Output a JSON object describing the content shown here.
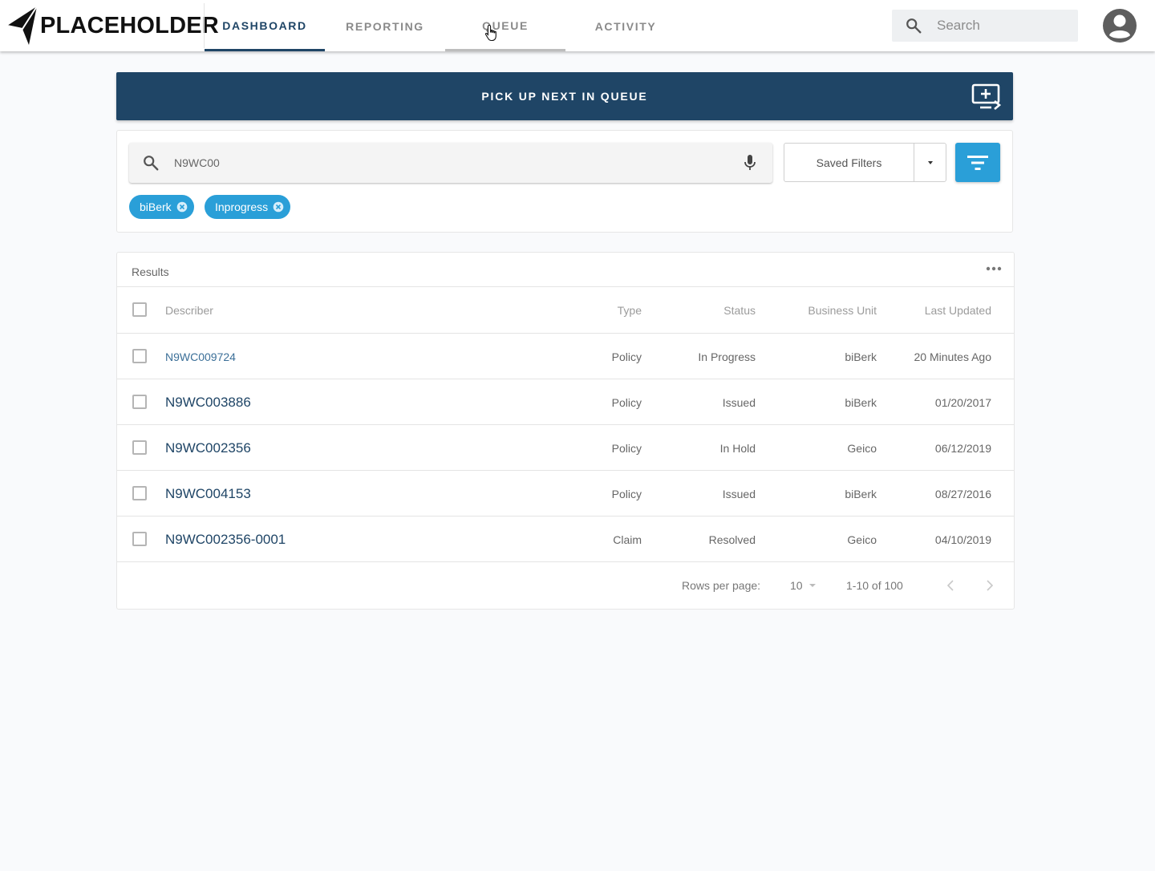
{
  "brand": {
    "name": "PLACEHOLDER"
  },
  "nav": {
    "tabs": [
      {
        "label": "DASHBOARD",
        "active": true
      },
      {
        "label": "REPORTING",
        "active": false
      },
      {
        "label": "QUEUE",
        "active": false,
        "hovered": true
      },
      {
        "label": "ACTIVITY",
        "active": false
      }
    ],
    "search": {
      "placeholder": "Search",
      "value": ""
    }
  },
  "colors": {
    "primary": "#1f4566",
    "accent": "#2a9fd8",
    "background": "#f9fafc"
  },
  "pickup": {
    "label": "PICK UP NEXT IN QUEUE",
    "icon": "add-to-queue-icon"
  },
  "filters": {
    "query": "N9WC00",
    "saved_filters_label": "Saved Filters",
    "chips": [
      {
        "label": "biBerk"
      },
      {
        "label": "Inprogress"
      }
    ]
  },
  "results": {
    "title": "Results",
    "columns": [
      "Describer",
      "Type",
      "Status",
      "Business Unit",
      "Last Updated"
    ],
    "rows": [
      {
        "describer": "N9WC009724",
        "type": "Policy",
        "status": "In Progress",
        "business_unit": "biBerk",
        "last_updated": "20 Minutes Ago"
      },
      {
        "describer": "N9WC003886",
        "type": "Policy",
        "status": "Issued",
        "business_unit": "biBerk",
        "last_updated": "01/20/2017"
      },
      {
        "describer": "N9WC002356",
        "type": "Policy",
        "status": "In Hold",
        "business_unit": "Geico",
        "last_updated": "06/12/2019"
      },
      {
        "describer": "N9WC004153",
        "type": "Policy",
        "status": "Issued",
        "business_unit": "biBerk",
        "last_updated": "08/27/2016"
      },
      {
        "describer": "N9WC002356-0001",
        "type": "Claim",
        "status": "Resolved",
        "business_unit": "Geico",
        "last_updated": "04/10/2019"
      }
    ],
    "pagination": {
      "rows_per_page_label": "Rows per page:",
      "rows_per_page": "10",
      "range": "1-10 of 100"
    }
  }
}
